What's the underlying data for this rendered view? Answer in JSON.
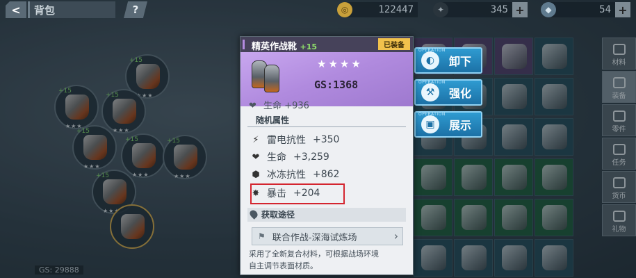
{
  "topbar": {
    "back_glyph": "<",
    "title": "背包",
    "help": "?",
    "coins": "122447",
    "wrench": "345",
    "crystal": "54",
    "plus": "+"
  },
  "web": {
    "gs": "GS: 29888"
  },
  "item": {
    "name": "精英作战靴",
    "plus_level": "+15",
    "equipped_badge": "已装备",
    "stars": "★★★★",
    "gs": "GS:1368",
    "base_attr": "生命 +936"
  },
  "random_attr_header": "随机属性",
  "attributes": [
    {
      "icon": "lightning-icon",
      "glyph": "⚡",
      "label": "雷电抗性",
      "value": "+350"
    },
    {
      "icon": "heart-icon",
      "glyph": "❤",
      "label": "生命",
      "value": "+3,259"
    },
    {
      "icon": "hexagon-icon",
      "glyph": "⬢",
      "label": "冰冻抗性",
      "value": "+862"
    },
    {
      "icon": "burst-icon",
      "glyph": "✸",
      "label": "暴击",
      "value": "+204"
    }
  ],
  "source": {
    "header": "获取途径",
    "button": "联合作战-深海试炼场",
    "description_line1": "采用了全新复合材料，可根据战场环境",
    "description_line2": "自主调节表面材质。"
  },
  "operations": [
    {
      "tag": "OPERATION",
      "label": "卸下",
      "icon": "unequip-icon"
    },
    {
      "tag": "OPERATION",
      "label": "强化",
      "icon": "enhance-icon"
    },
    {
      "tag": "OPERATION",
      "label": "展示",
      "icon": "showcase-icon"
    }
  ],
  "side_tabs": [
    "材料",
    "装备",
    "零件",
    "任务",
    "货币",
    "礼物"
  ],
  "colors": {
    "panel_accent": "#b48be0",
    "highlight": "#d4252f",
    "op_button": "#2f9bd1",
    "equipped_badge": "#f1c14c"
  }
}
